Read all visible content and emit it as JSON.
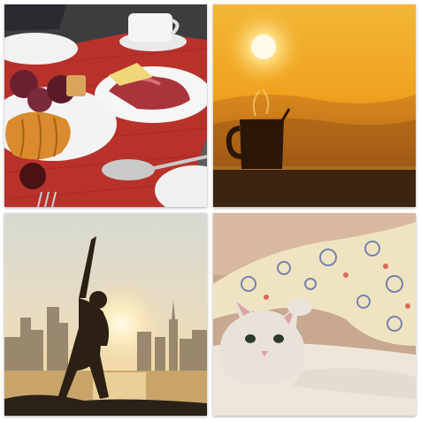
{
  "collage": {
    "tiles": [
      {
        "id": "breakfast",
        "subject": "breakfast-table"
      },
      {
        "id": "sunrise",
        "subject": "coffee-mug-at-sunrise"
      },
      {
        "id": "yoga",
        "subject": "yoga-silhouette-city-skyline"
      },
      {
        "id": "cat",
        "subject": "cat-under-blanket"
      }
    ]
  },
  "colors": {
    "placemat": "#b8322b",
    "sunrise_sky": "#f0a21e",
    "yoga_water": "#c9a46a",
    "cat_blanket": "#efe4c2"
  }
}
